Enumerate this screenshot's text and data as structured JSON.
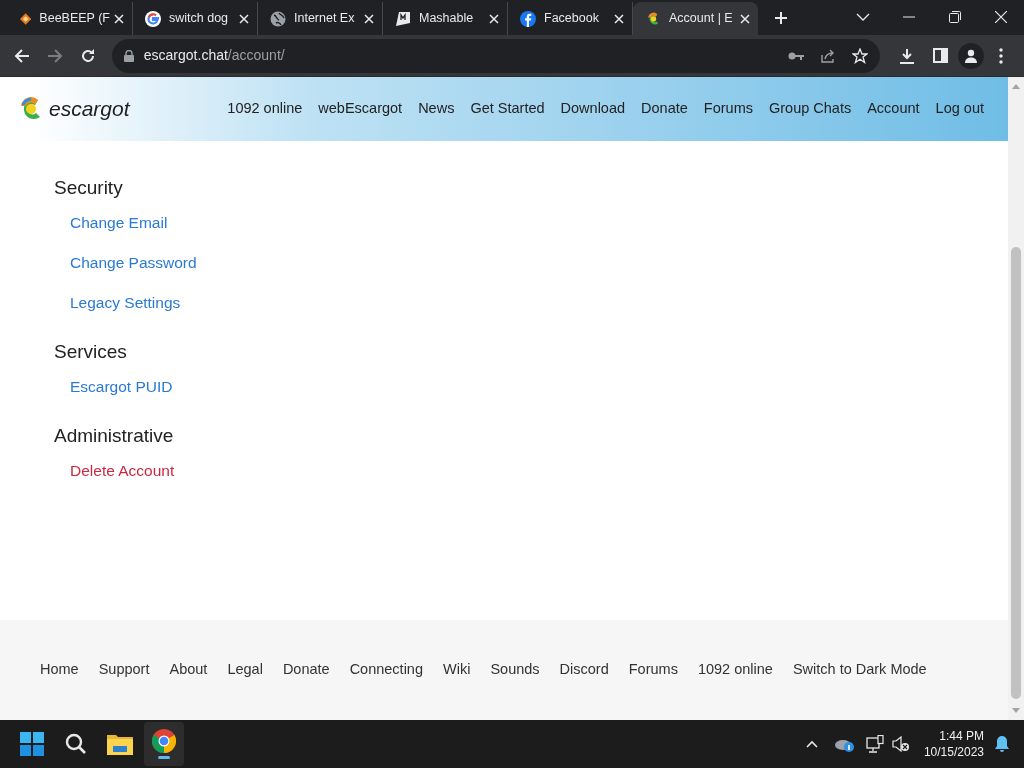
{
  "browser": {
    "tabs": [
      {
        "label": "BeeBEEP (F",
        "kind": "diamond",
        "selected": false
      },
      {
        "label": "switch dog",
        "kind": "google",
        "selected": false
      },
      {
        "label": "Internet Ex",
        "kind": "globe",
        "selected": false
      },
      {
        "label": "Mashable",
        "kind": "mashable",
        "selected": false
      },
      {
        "label": "Facebook",
        "kind": "facebook",
        "selected": false
      },
      {
        "label": "Account | E",
        "kind": "escargot",
        "selected": true
      }
    ],
    "url_host": "escargot.chat",
    "url_path": "/account/"
  },
  "site": {
    "logo": "escargot",
    "nav": [
      "1092 online",
      "webEscargot",
      "News",
      "Get Started",
      "Download",
      "Donate",
      "Forums",
      "Group Chats",
      "Account",
      "Log out"
    ],
    "sections": [
      {
        "heading": "Security",
        "links": [
          {
            "label": "Change Email",
            "kind": "normal"
          },
          {
            "label": "Change Password",
            "kind": "normal"
          },
          {
            "label": "Legacy Settings",
            "kind": "normal"
          }
        ]
      },
      {
        "heading": "Services",
        "links": [
          {
            "label": "Escargot PUID",
            "kind": "normal"
          }
        ]
      },
      {
        "heading": "Administrative",
        "links": [
          {
            "label": "Delete Account",
            "kind": "danger"
          }
        ]
      }
    ],
    "footer": [
      "Home",
      "Support",
      "About",
      "Legal",
      "Donate",
      "Connecting",
      "Wiki",
      "Sounds",
      "Discord",
      "Forums",
      "1092 online",
      "Switch to Dark Mode"
    ]
  },
  "taskbar": {
    "time": "1:44 PM",
    "date": "10/15/2023"
  }
}
